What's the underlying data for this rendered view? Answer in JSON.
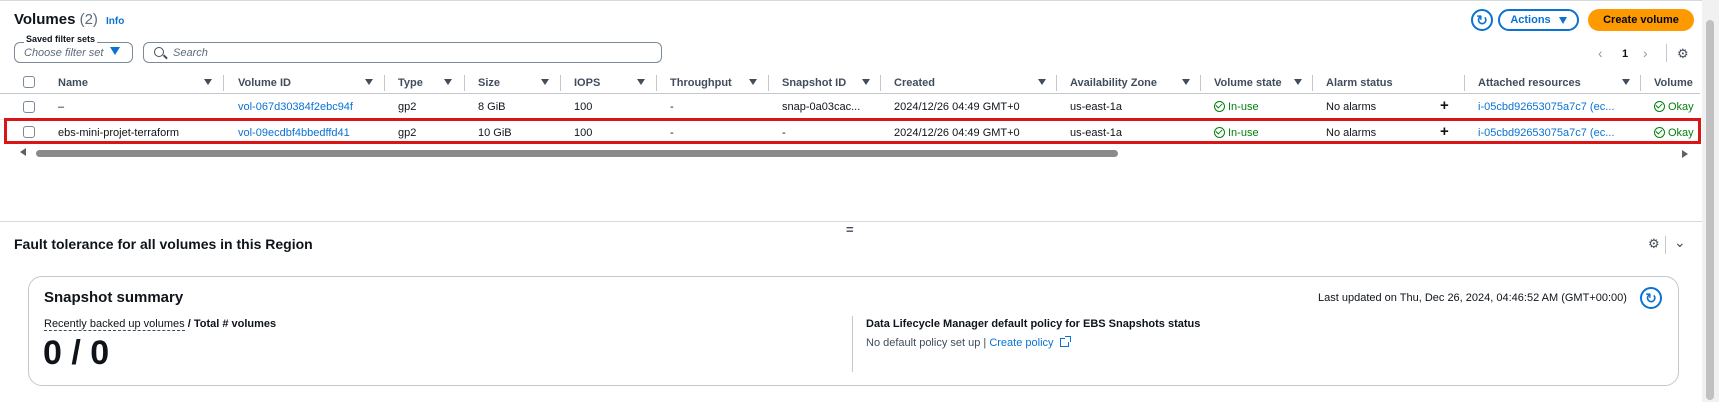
{
  "header": {
    "title": "Volumes",
    "count": "(2)",
    "info": "Info",
    "actions_label": "Actions",
    "create_label": "Create volume"
  },
  "filters": {
    "saved_legend": "Saved filter sets",
    "saved_placeholder": "Choose filter set",
    "search_placeholder": "Search"
  },
  "pagination": {
    "current_page": "1"
  },
  "table": {
    "columns": [
      "Name",
      "Volume ID",
      "Type",
      "Size",
      "IOPS",
      "Throughput",
      "Snapshot ID",
      "Created",
      "Availability Zone",
      "Volume state",
      "Alarm status",
      "Attached resources",
      "Volume"
    ],
    "rows": [
      {
        "name": "–",
        "volume_id": "vol-067d30384f2ebc94f",
        "type": "gp2",
        "size": "8 GiB",
        "iops": "100",
        "throughput": "-",
        "snapshot_id": "snap-0a03cac...",
        "created": "2024/12/26 04:49 GMT+0",
        "az": "us-east-1a",
        "state": "In-use",
        "alarm": "No alarms",
        "attached": "i-05cbd92653075a7c7 (ec...",
        "volume_status": "Okay"
      },
      {
        "name": "ebs-mini-projet-terraform",
        "volume_id": "vol-09ecdbf4bbedffd41",
        "type": "gp2",
        "size": "10 GiB",
        "iops": "100",
        "throughput": "-",
        "snapshot_id": "-",
        "created": "2024/12/26 04:49 GMT+0",
        "az": "us-east-1a",
        "state": "In-use",
        "alarm": "No alarms",
        "attached": "i-05cbd92653075a7c7 (ec...",
        "volume_status": "Okay"
      }
    ]
  },
  "fault": {
    "title": "Fault tolerance for all volumes in this Region",
    "card_title": "Snapshot summary",
    "last_updated": "Last updated on Thu, Dec 26, 2024, 04:46:52 AM (GMT+00:00)",
    "recent_label": "Recently backed up volumes",
    "total_label": "/ Total # volumes",
    "big_value": "0 / 0",
    "dlm_title": "Data Lifecycle Manager default policy for EBS Snapshots status",
    "dlm_text": "No default policy set up |",
    "create_policy": "Create policy"
  },
  "colors": {
    "accent": "#0972d3",
    "primary_button": "#ff9900",
    "success": "#037f0c",
    "selected_outline": "#d91515"
  },
  "icons": [
    "refresh-icon",
    "caret-down-icon",
    "search-icon",
    "chevron-left-icon",
    "chevron-right-icon",
    "gear-icon",
    "sort-icon",
    "check-circle-icon",
    "plus-icon",
    "chevron-down-icon",
    "external-link-icon",
    "drag-handle-icon"
  ]
}
